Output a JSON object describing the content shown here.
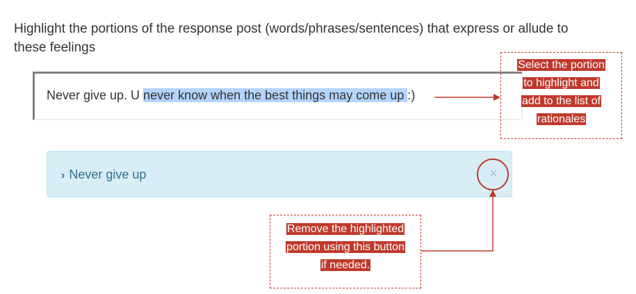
{
  "instruction": "Highlight the portions of the response post (words/phrases/sentences) that express or allude to these feelings",
  "post": {
    "text_before": "Never give up. U ",
    "highlighted": "never know when the best things may come up ",
    "text_after": ":)"
  },
  "rationales": [
    {
      "chevron": "›",
      "label": "Never give up",
      "remove_symbol": "×"
    }
  ],
  "callouts": {
    "select": {
      "lines": [
        "Select the portion",
        "to highlight and",
        "add to the list of",
        "rationales"
      ]
    },
    "remove": {
      "lines": [
        "Remove the highlighted",
        "portion using this button",
        "if needed."
      ]
    }
  },
  "colors": {
    "highlight": "#b3d4fc",
    "annotation": "#c0392b",
    "rationale_bg": "#d9edf7",
    "rationale_text": "#31708f"
  },
  "icons": {
    "rationale_toggle": "chevron-right-icon",
    "remove": "close-icon"
  }
}
